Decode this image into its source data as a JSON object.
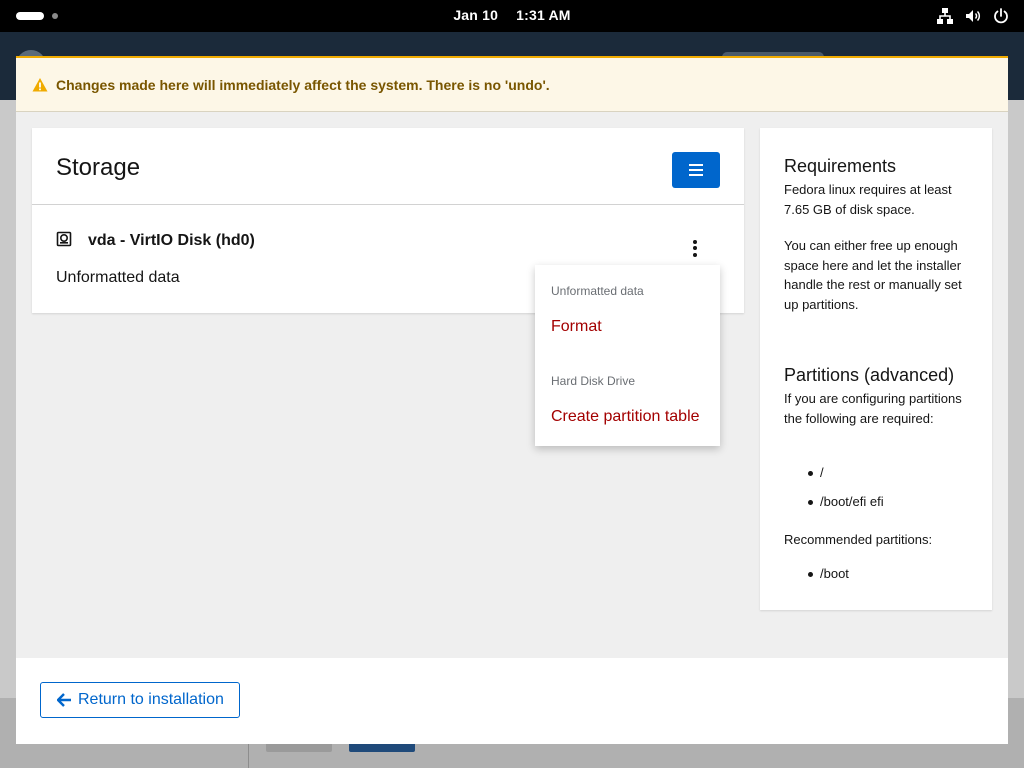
{
  "topbar": {
    "date": "Jan 10",
    "time": "1:31 AM",
    "icons": [
      "activities-indicator",
      "network-icon",
      "volume-icon",
      "power-icon"
    ]
  },
  "alert": {
    "icon": "warning-icon",
    "text": "Changes made here will immediately affect the system. There is no 'undo'.",
    "color": "#795600"
  },
  "storage": {
    "title": "Storage",
    "menu_icon": "hamburger-icon",
    "disk": {
      "icon": "hard-disk-icon",
      "name": "vda - VirtIO Disk (hd0)",
      "description": "Unformatted data"
    },
    "dropdown": {
      "groups": [
        {
          "label": "Unformatted data",
          "items": [
            "Format"
          ]
        },
        {
          "label": "Hard Disk Drive",
          "items": [
            "Create partition table"
          ]
        }
      ]
    }
  },
  "sidebar": {
    "requirements": {
      "title": "Requirements",
      "text1": "Fedora linux requires at least 7.65 GB of disk space.",
      "text2": "You can either free up enough space here and let the installer handle the rest or manually set up partitions."
    },
    "partitions": {
      "title": "Partitions (advanced)",
      "text": "If you are configuring partitions the following are required:",
      "required": [
        "/",
        "/boot/efi efi"
      ],
      "recommended_label": "Recommended partitions:",
      "recommended": [
        "/boot"
      ]
    }
  },
  "footer": {
    "return_label": "Return to installation"
  },
  "colors": {
    "accent": "#0066cc",
    "danger_link": "#a30000",
    "warning": "#f0ab00"
  }
}
